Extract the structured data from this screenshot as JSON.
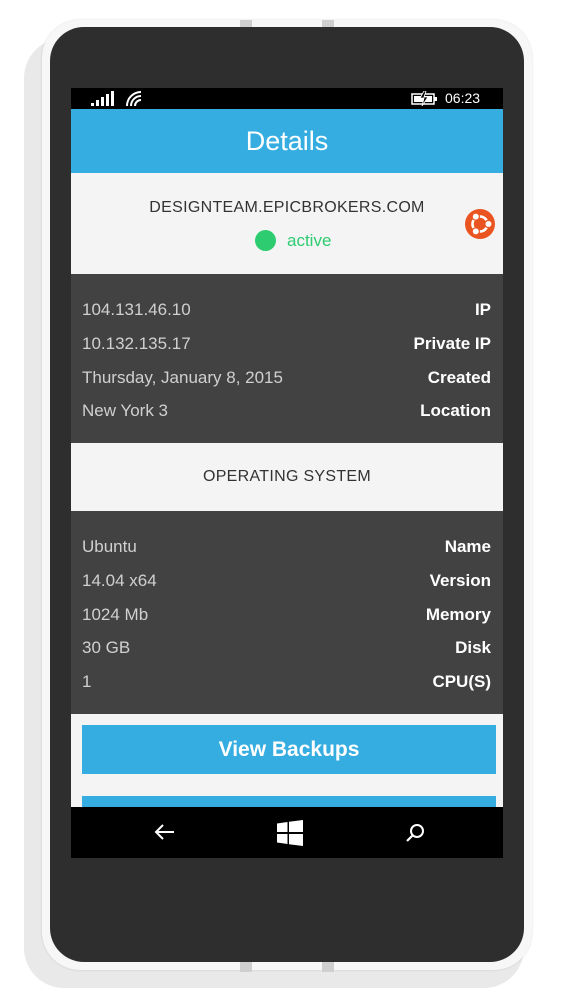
{
  "status_bar": {
    "time": "06:23"
  },
  "header": {
    "title": "Details"
  },
  "server": {
    "hostname": "DESIGNTEAM.EPICBROKERS.COM",
    "status": "active",
    "status_color": "#2ecc71"
  },
  "network_info": [
    {
      "value": "104.131.46.10",
      "label": "IP"
    },
    {
      "value": "10.132.135.17",
      "label": "Private IP"
    },
    {
      "value": "Thursday, January 8, 2015",
      "label": "Created"
    },
    {
      "value": "New York 3",
      "label": "Location"
    }
  ],
  "os_section": {
    "title": "OPERATING SYSTEM"
  },
  "os_info": [
    {
      "value": "Ubuntu",
      "label": "Name"
    },
    {
      "value": "14.04 x64",
      "label": "Version"
    },
    {
      "value": "1024 Mb",
      "label": "Memory"
    },
    {
      "value": "30 GB",
      "label": "Disk"
    },
    {
      "value": "1",
      "label": "CPU(S)"
    }
  ],
  "actions": {
    "view_backups": "View Backups"
  },
  "icons": {
    "os_logo": "ubuntu-icon",
    "nav": [
      "back-arrow-icon",
      "windows-start-icon",
      "search-icon"
    ]
  },
  "colors": {
    "accent": "#35ade1",
    "dark_panel": "#424242",
    "os_logo": "#e95420"
  }
}
